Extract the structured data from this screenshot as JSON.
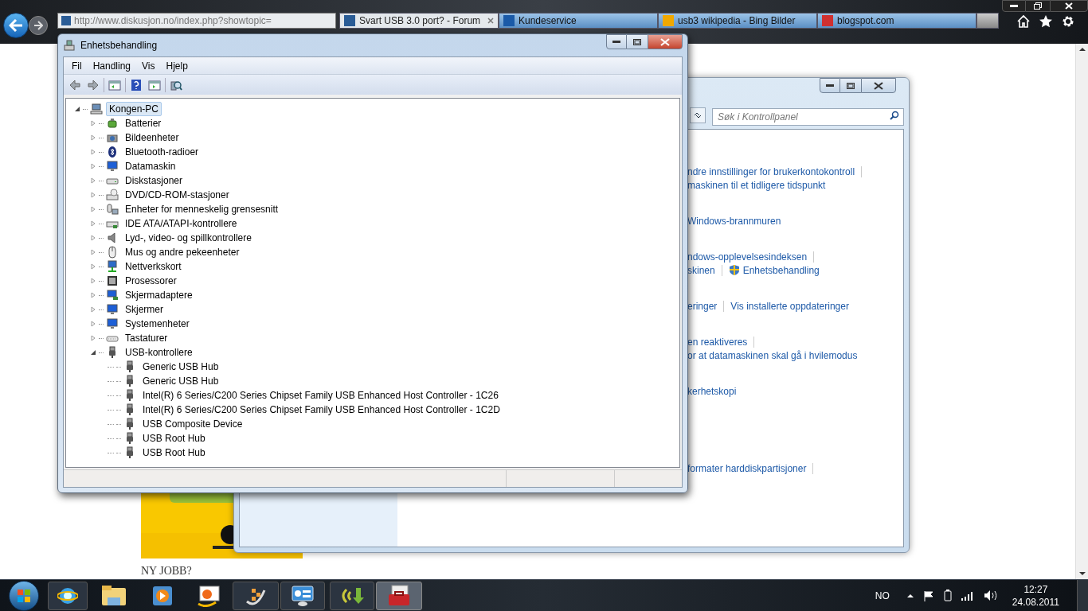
{
  "browser": {
    "address": "http://www.diskusjon.no/index.php?showtopic=",
    "tabs": [
      {
        "title": "Svart USB 3.0 port? - Forum",
        "selected": true,
        "color": "#2a5c96"
      },
      {
        "title": "Kundeservice",
        "selected": false,
        "color": "#1a5aa8"
      },
      {
        "title": "usb3 wikipedia - Bing Bilder",
        "selected": false,
        "color": "#f0a800"
      },
      {
        "title": "blogspot.com",
        "selected": false,
        "color": "#d03030"
      }
    ],
    "page": {
      "heading": "NY JOBB?"
    }
  },
  "control_panel": {
    "search_placeholder": "Søk i Kontrollpanel",
    "groups": [
      [
        [
          {
            "text": "ndre innstillinger for brukerkontokontroll",
            "kind": "link",
            "separator": true
          }
        ],
        [
          {
            "text": "maskinen til et tidligere tidspunkt",
            "kind": "link",
            "separator": false
          }
        ]
      ],
      [
        [
          {
            "text": "Windows-brannmuren",
            "kind": "link",
            "separator": false
          }
        ]
      ],
      [
        [
          {
            "text": "ndows-opplevelsesindeksen",
            "kind": "link",
            "separator": true
          }
        ],
        [
          {
            "text": "skinen",
            "kind": "link",
            "separator": true
          },
          {
            "text": "Enhetsbehandling",
            "kind": "shield-link",
            "separator": false
          }
        ]
      ],
      [
        [
          {
            "text": "eringer",
            "kind": "link",
            "separator": true
          },
          {
            "text": "Vis installerte oppdateringer",
            "kind": "link",
            "separator": false
          }
        ]
      ],
      [
        [
          {
            "text": "en reaktiveres",
            "kind": "link",
            "separator": true
          }
        ],
        [
          {
            "text": "or at datamaskinen skal gå i hvilemodus",
            "kind": "link",
            "separator": false
          }
        ]
      ],
      [
        [
          {
            "text": "kerhetskopi",
            "kind": "link",
            "separator": false
          }
        ]
      ],
      [
        [
          {
            "text": "formater harddiskpartisjoner",
            "kind": "link",
            "separator": true
          }
        ]
      ]
    ]
  },
  "device_manager": {
    "title": "Enhetsbehandling",
    "menu": [
      "Fil",
      "Handling",
      "Vis",
      "Hjelp"
    ],
    "tree": {
      "label": "Kongen-PC",
      "kind": "computer",
      "expanded": true,
      "selected": true,
      "children": [
        {
          "label": "Batterier",
          "kind": "battery",
          "expanded": false,
          "selected": false
        },
        {
          "label": "Bildeenheter",
          "kind": "camera",
          "expanded": false,
          "selected": false
        },
        {
          "label": "Bluetooth-radioer",
          "kind": "bluetooth",
          "expanded": false,
          "selected": false
        },
        {
          "label": "Datamaskin",
          "kind": "monitor",
          "expanded": false,
          "selected": false
        },
        {
          "label": "Diskstasjoner",
          "kind": "disk",
          "expanded": false,
          "selected": false
        },
        {
          "label": "DVD/CD-ROM-stasjoner",
          "kind": "dvd",
          "expanded": false,
          "selected": false
        },
        {
          "label": "Enheter for menneskelig grensesnitt",
          "kind": "hid",
          "expanded": false,
          "selected": false
        },
        {
          "label": "IDE ATA/ATAPI-kontrollere",
          "kind": "ide",
          "expanded": false,
          "selected": false
        },
        {
          "label": "Lyd-, video- og spillkontrollere",
          "kind": "sound",
          "expanded": false,
          "selected": false
        },
        {
          "label": "Mus og andre pekeenheter",
          "kind": "mouse",
          "expanded": false,
          "selected": false
        },
        {
          "label": "Nettverkskort",
          "kind": "network",
          "expanded": false,
          "selected": false
        },
        {
          "label": "Prosessorer",
          "kind": "cpu",
          "expanded": false,
          "selected": false
        },
        {
          "label": "Skjermadaptere",
          "kind": "display",
          "expanded": false,
          "selected": false
        },
        {
          "label": "Skjermer",
          "kind": "monitor",
          "expanded": false,
          "selected": false
        },
        {
          "label": "Systemenheter",
          "kind": "monitor",
          "expanded": false,
          "selected": false
        },
        {
          "label": "Tastaturer",
          "kind": "keyboard",
          "expanded": false,
          "selected": false
        },
        {
          "label": "USB-kontrollere",
          "kind": "usb",
          "expanded": true,
          "selected": false,
          "children": [
            {
              "label": "Generic USB Hub",
              "kind": "usb",
              "selected": false
            },
            {
              "label": "Generic USB Hub",
              "kind": "usb",
              "selected": false
            },
            {
              "label": "Intel(R) 6 Series/C200 Series Chipset Family USB Enhanced Host Controller - 1C26",
              "kind": "usb",
              "selected": false
            },
            {
              "label": "Intel(R) 6 Series/C200 Series Chipset Family USB Enhanced Host Controller - 1C2D",
              "kind": "usb",
              "selected": false
            },
            {
              "label": "USB Composite Device",
              "kind": "usb",
              "selected": false
            },
            {
              "label": "USB Root Hub",
              "kind": "usb",
              "selected": false
            },
            {
              "label": "USB Root Hub",
              "kind": "usb",
              "selected": false
            }
          ]
        }
      ]
    }
  },
  "taskbar": {
    "language": "NO",
    "time": "12:27",
    "date": "24.08.2011"
  }
}
